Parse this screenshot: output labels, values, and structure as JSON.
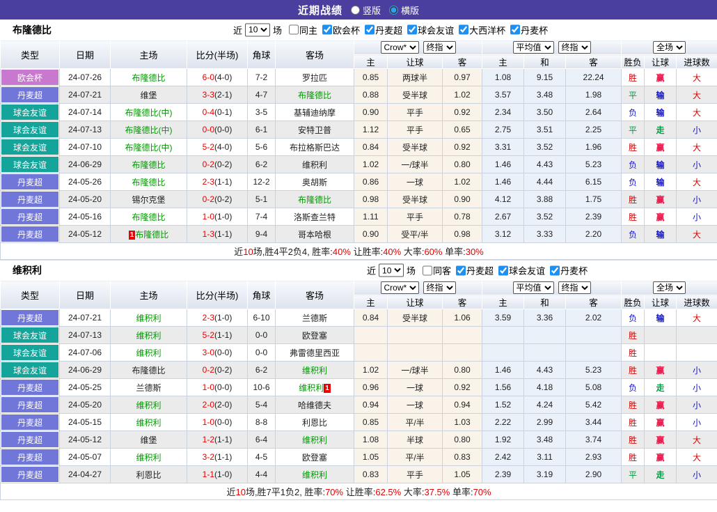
{
  "title_bar": {
    "title": "近期战绩",
    "radios": [
      {
        "label": "竖版",
        "selected": false
      },
      {
        "label": "横版",
        "selected": true
      }
    ]
  },
  "columns": {
    "main": [
      "类型",
      "日期",
      "主场",
      "比分(半场)",
      "角球",
      "客场"
    ],
    "sub": [
      "主",
      "让球",
      "客",
      "主",
      "和",
      "客",
      "胜负",
      "让球",
      "进球数"
    ],
    "selects": {
      "group1": [
        "Crow*",
        "终指"
      ],
      "group2": [
        "平均值",
        "终指"
      ],
      "group3": [
        "全场"
      ]
    }
  },
  "colors": {
    "title_bar_bg": "#4a3e9e",
    "focus_team": "#009900",
    "score_red": "#e60000",
    "summary_red": "#e60000",
    "league_badges": {
      "欧会杯": "#c878ce",
      "丹麦超": "#7177d9",
      "球会友谊": "#15a49a"
    },
    "result_colors": {
      "胜": "#d40000",
      "负": "#1515cc",
      "平": "#009944",
      "赢": "#e8194b",
      "输": "#1515cc",
      "走": "#009944",
      "大": "#d40000",
      "小": "#1515cc"
    }
  },
  "tables": [
    {
      "team": "布隆德比",
      "filter": {
        "prefix": "近",
        "matches": "10",
        "suffix": "场",
        "same": {
          "label": "同主",
          "checked": false
        },
        "leagues": [
          {
            "label": "欧会杯",
            "checked": true
          },
          {
            "label": "丹麦超",
            "checked": true
          },
          {
            "label": "球会友谊",
            "checked": true
          },
          {
            "label": "大西洋杯",
            "checked": true
          },
          {
            "label": "丹麦杯",
            "checked": true
          }
        ]
      },
      "rows": [
        {
          "league": "欧会杯",
          "date": "24-07-26",
          "home": "布隆德比",
          "home_focus": true,
          "home_card": "",
          "score": "6-0",
          "half": "(4-0)",
          "corner": "7-2",
          "away": "罗拉匹",
          "away_focus": false,
          "away_card": "",
          "o1": "0.85",
          "o2": "两球半",
          "o3": "0.97",
          "a1": "1.08",
          "a2": "9.15",
          "a3": "22.24",
          "r1": "胜",
          "r2": "赢",
          "r3": "大"
        },
        {
          "league": "丹麦超",
          "date": "24-07-21",
          "home": "维堡",
          "home_focus": false,
          "home_card": "",
          "score": "3-3",
          "half": "(2-1)",
          "corner": "4-7",
          "away": "布隆德比",
          "away_focus": true,
          "away_card": "",
          "o1": "0.88",
          "o2": "受半球",
          "o3": "1.02",
          "a1": "3.57",
          "a2": "3.48",
          "a3": "1.98",
          "r1": "平",
          "r2": "输",
          "r3": "大"
        },
        {
          "league": "球会友谊",
          "date": "24-07-14",
          "home": "布隆德比(中)",
          "home_focus": true,
          "home_card": "",
          "score": "0-4",
          "half": "(0-1)",
          "corner": "3-5",
          "away": "基辅迪纳摩",
          "away_focus": false,
          "away_card": "",
          "o1": "0.90",
          "o2": "平手",
          "o3": "0.92",
          "a1": "2.34",
          "a2": "3.50",
          "a3": "2.64",
          "r1": "负",
          "r2": "输",
          "r3": "大"
        },
        {
          "league": "球会友谊",
          "date": "24-07-13",
          "home": "布隆德比(中)",
          "home_focus": true,
          "home_card": "",
          "score": "0-0",
          "half": "(0-0)",
          "corner": "6-1",
          "away": "安特卫普",
          "away_focus": false,
          "away_card": "",
          "o1": "1.12",
          "o2": "平手",
          "o3": "0.65",
          "a1": "2.75",
          "a2": "3.51",
          "a3": "2.25",
          "r1": "平",
          "r2": "走",
          "r3": "小"
        },
        {
          "league": "球会友谊",
          "date": "24-07-10",
          "home": "布隆德比(中)",
          "home_focus": true,
          "home_card": "",
          "score": "5-2",
          "half": "(4-0)",
          "corner": "5-6",
          "away": "布拉格斯巴达",
          "away_focus": false,
          "away_card": "",
          "o1": "0.84",
          "o2": "受半球",
          "o3": "0.92",
          "a1": "3.31",
          "a2": "3.52",
          "a3": "1.96",
          "r1": "胜",
          "r2": "赢",
          "r3": "大"
        },
        {
          "league": "球会友谊",
          "date": "24-06-29",
          "home": "布隆德比",
          "home_focus": true,
          "home_card": "",
          "score": "0-2",
          "half": "(0-2)",
          "corner": "6-2",
          "away": "维积利",
          "away_focus": false,
          "away_card": "",
          "o1": "1.02",
          "o2": "一/球半",
          "o3": "0.80",
          "a1": "1.46",
          "a2": "4.43",
          "a3": "5.23",
          "r1": "负",
          "r2": "输",
          "r3": "小"
        },
        {
          "league": "丹麦超",
          "date": "24-05-26",
          "home": "布隆德比",
          "home_focus": true,
          "home_card": "",
          "score": "2-3",
          "half": "(1-1)",
          "corner": "12-2",
          "away": "奥胡斯",
          "away_focus": false,
          "away_card": "",
          "o1": "0.86",
          "o2": "一球",
          "o3": "1.02",
          "a1": "1.46",
          "a2": "4.44",
          "a3": "6.15",
          "r1": "负",
          "r2": "输",
          "r3": "大"
        },
        {
          "league": "丹麦超",
          "date": "24-05-20",
          "home": "锡尔克堡",
          "home_focus": false,
          "home_card": "",
          "score": "0-2",
          "half": "(0-2)",
          "corner": "5-1",
          "away": "布隆德比",
          "away_focus": true,
          "away_card": "",
          "o1": "0.98",
          "o2": "受半球",
          "o3": "0.90",
          "a1": "4.12",
          "a2": "3.88",
          "a3": "1.75",
          "r1": "胜",
          "r2": "赢",
          "r3": "小"
        },
        {
          "league": "丹麦超",
          "date": "24-05-16",
          "home": "布隆德比",
          "home_focus": true,
          "home_card": "",
          "score": "1-0",
          "half": "(1-0)",
          "corner": "7-4",
          "away": "洛斯查兰特",
          "away_focus": false,
          "away_card": "",
          "o1": "1.11",
          "o2": "平手",
          "o3": "0.78",
          "a1": "2.67",
          "a2": "3.52",
          "a3": "2.39",
          "r1": "胜",
          "r2": "赢",
          "r3": "小"
        },
        {
          "league": "丹麦超",
          "date": "24-05-12",
          "home": "布隆德比",
          "home_focus": true,
          "home_card": "1",
          "score": "1-3",
          "half": "(1-1)",
          "corner": "9-4",
          "away": "哥本哈根",
          "away_focus": false,
          "away_card": "",
          "o1": "0.90",
          "o2": "受平/半",
          "o3": "0.98",
          "a1": "3.12",
          "a2": "3.33",
          "a3": "2.20",
          "r1": "负",
          "r2": "输",
          "r3": "大"
        }
      ],
      "summary": [
        {
          "text": "近",
          "red": false
        },
        {
          "text": "10",
          "red": true
        },
        {
          "text": "场,胜4平2负4, 胜率:",
          "red": false
        },
        {
          "text": "40%",
          "red": true
        },
        {
          "text": " 让胜率:",
          "red": false
        },
        {
          "text": "40%",
          "red": true
        },
        {
          "text": " 大率:",
          "red": false
        },
        {
          "text": "60%",
          "red": true
        },
        {
          "text": " 单率:",
          "red": false
        },
        {
          "text": "30%",
          "red": true
        }
      ]
    },
    {
      "team": "维积利",
      "filter": {
        "prefix": "近",
        "matches": "10",
        "suffix": "场",
        "same": {
          "label": "同客",
          "checked": false
        },
        "leagues": [
          {
            "label": "丹麦超",
            "checked": true
          },
          {
            "label": "球会友谊",
            "checked": true
          },
          {
            "label": "丹麦杯",
            "checked": true
          }
        ]
      },
      "rows": [
        {
          "league": "丹麦超",
          "date": "24-07-21",
          "home": "维积利",
          "home_focus": true,
          "home_card": "",
          "score": "2-3",
          "half": "(1-0)",
          "corner": "6-10",
          "away": "兰德斯",
          "away_focus": false,
          "away_card": "",
          "o1": "0.84",
          "o2": "受半球",
          "o3": "1.06",
          "a1": "3.59",
          "a2": "3.36",
          "a3": "2.02",
          "r1": "负",
          "r2": "输",
          "r3": "大"
        },
        {
          "league": "球会友谊",
          "date": "24-07-13",
          "home": "维积利",
          "home_focus": true,
          "home_card": "",
          "score": "5-2",
          "half": "(1-1)",
          "corner": "0-0",
          "away": "欧登塞",
          "away_focus": false,
          "away_card": "",
          "o1": "",
          "o2": "",
          "o3": "",
          "a1": "",
          "a2": "",
          "a3": "",
          "r1": "胜",
          "r2": "",
          "r3": ""
        },
        {
          "league": "球会友谊",
          "date": "24-07-06",
          "home": "维积利",
          "home_focus": true,
          "home_card": "",
          "score": "3-0",
          "half": "(0-0)",
          "corner": "0-0",
          "away": "弗雷德里西亚",
          "away_focus": false,
          "away_card": "",
          "o1": "",
          "o2": "",
          "o3": "",
          "a1": "",
          "a2": "",
          "a3": "",
          "r1": "胜",
          "r2": "",
          "r3": ""
        },
        {
          "league": "球会友谊",
          "date": "24-06-29",
          "home": "布隆德比",
          "home_focus": false,
          "home_card": "",
          "score": "0-2",
          "half": "(0-2)",
          "corner": "6-2",
          "away": "维积利",
          "away_focus": true,
          "away_card": "",
          "o1": "1.02",
          "o2": "一/球半",
          "o3": "0.80",
          "a1": "1.46",
          "a2": "4.43",
          "a3": "5.23",
          "r1": "胜",
          "r2": "赢",
          "r3": "小"
        },
        {
          "league": "丹麦超",
          "date": "24-05-25",
          "home": "兰德斯",
          "home_focus": false,
          "home_card": "",
          "score": "1-0",
          "half": "(0-0)",
          "corner": "10-6",
          "away": "维积利",
          "away_focus": true,
          "away_card": "1",
          "o1": "0.96",
          "o2": "一球",
          "o3": "0.92",
          "a1": "1.56",
          "a2": "4.18",
          "a3": "5.08",
          "r1": "负",
          "r2": "走",
          "r3": "小"
        },
        {
          "league": "丹麦超",
          "date": "24-05-20",
          "home": "维积利",
          "home_focus": true,
          "home_card": "",
          "score": "2-0",
          "half": "(2-0)",
          "corner": "5-4",
          "away": "哈维德夫",
          "away_focus": false,
          "away_card": "",
          "o1": "0.94",
          "o2": "一球",
          "o3": "0.94",
          "a1": "1.52",
          "a2": "4.24",
          "a3": "5.42",
          "r1": "胜",
          "r2": "赢",
          "r3": "小"
        },
        {
          "league": "丹麦超",
          "date": "24-05-15",
          "home": "维积利",
          "home_focus": true,
          "home_card": "",
          "score": "1-0",
          "half": "(0-0)",
          "corner": "8-8",
          "away": "利恩比",
          "away_focus": false,
          "away_card": "",
          "o1": "0.85",
          "o2": "平/半",
          "o3": "1.03",
          "a1": "2.22",
          "a2": "2.99",
          "a3": "3.44",
          "r1": "胜",
          "r2": "赢",
          "r3": "小"
        },
        {
          "league": "丹麦超",
          "date": "24-05-12",
          "home": "维堡",
          "home_focus": false,
          "home_card": "",
          "score": "1-2",
          "half": "(1-1)",
          "corner": "6-4",
          "away": "维积利",
          "away_focus": true,
          "away_card": "",
          "o1": "1.08",
          "o2": "半球",
          "o3": "0.80",
          "a1": "1.92",
          "a2": "3.48",
          "a3": "3.74",
          "r1": "胜",
          "r2": "赢",
          "r3": "大"
        },
        {
          "league": "丹麦超",
          "date": "24-05-07",
          "home": "维积利",
          "home_focus": true,
          "home_card": "",
          "score": "3-2",
          "half": "(1-1)",
          "corner": "4-5",
          "away": "欧登塞",
          "away_focus": false,
          "away_card": "",
          "o1": "1.05",
          "o2": "平/半",
          "o3": "0.83",
          "a1": "2.42",
          "a2": "3.11",
          "a3": "2.93",
          "r1": "胜",
          "r2": "赢",
          "r3": "大"
        },
        {
          "league": "丹麦超",
          "date": "24-04-27",
          "home": "利恩比",
          "home_focus": false,
          "home_card": "",
          "score": "1-1",
          "half": "(1-0)",
          "corner": "4-4",
          "away": "维积利",
          "away_focus": true,
          "away_card": "",
          "o1": "0.83",
          "o2": "平手",
          "o3": "1.05",
          "a1": "2.39",
          "a2": "3.19",
          "a3": "2.90",
          "r1": "平",
          "r2": "走",
          "r3": "小"
        }
      ],
      "summary": [
        {
          "text": "近",
          "red": false
        },
        {
          "text": "10",
          "red": true
        },
        {
          "text": "场,胜7平1负2, 胜率:",
          "red": false
        },
        {
          "text": "70%",
          "red": true
        },
        {
          "text": " 让胜率:",
          "red": false
        },
        {
          "text": "62.5%",
          "red": true
        },
        {
          "text": " 大率:",
          "red": false
        },
        {
          "text": "37.5%",
          "red": true
        },
        {
          "text": " 单率:",
          "red": false
        },
        {
          "text": "70%",
          "red": true
        }
      ]
    }
  ]
}
